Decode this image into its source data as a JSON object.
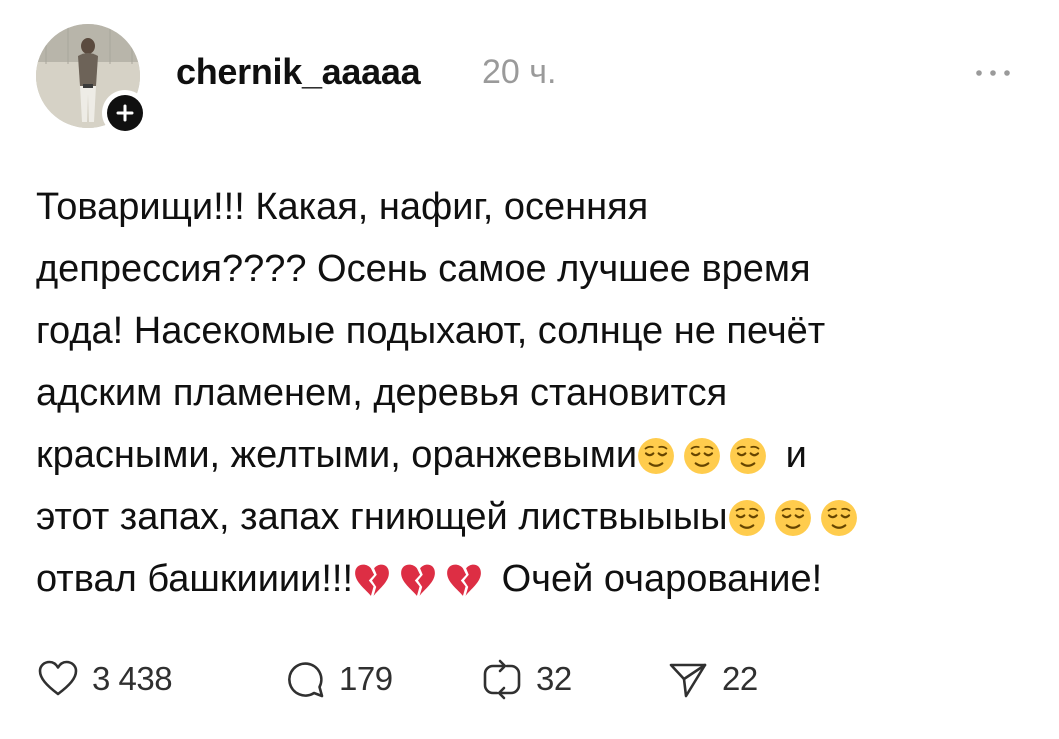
{
  "post": {
    "username": "chernik_aaaaa",
    "timestamp": "20 ч.",
    "text_lines": [
      "Товарищи!!! Какая, нафиг, осенняя",
      "депрессия???? Осень самое лучшее время",
      "года! Насекомые подыхают, солнце не печёт",
      "адским пламенем, деревья становится",
      "красными, желтыми, оранжевыми",
      "и",
      "этот запах, запах гниющей листвыыыы",
      "отвал башкииии!!!",
      "Очей очарование!"
    ],
    "emojis": {
      "relieved_face": "relieved-face-icon",
      "broken_heart": "broken-heart-icon"
    }
  },
  "actions": {
    "likes": "3 438",
    "comments": "179",
    "reposts": "32",
    "shares": "22"
  },
  "colors": {
    "text": "#101010",
    "muted": "#9a9a9a",
    "emoji_face": "#ffcc4d",
    "broken_heart": "#dd2e44"
  }
}
